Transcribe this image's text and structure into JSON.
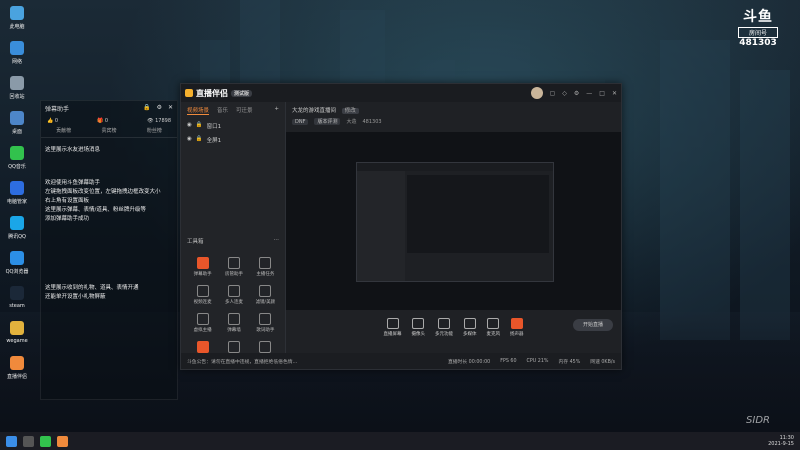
{
  "desktop": {
    "icons": [
      {
        "label": "此电脑",
        "color": "#4aa3df"
      },
      {
        "label": "网络",
        "color": "#3a8edb"
      },
      {
        "label": "回收站",
        "color": "#8a9aa8"
      },
      {
        "label": "桌面",
        "color": "#4d86c9"
      },
      {
        "label": "QQ音乐",
        "color": "#32c24d"
      },
      {
        "label": "电脑管家",
        "color": "#2d6de0"
      },
      {
        "label": "腾讯QQ",
        "color": "#1aa6e8"
      },
      {
        "label": "QQ浏览器",
        "color": "#2c8fe6"
      },
      {
        "label": "steam",
        "color": "#1b2838"
      },
      {
        "label": "wegame",
        "color": "#e2b23d"
      },
      {
        "label": "直播伴侣",
        "color": "#f08a3c"
      }
    ]
  },
  "room_badge": {
    "logo": "斗鱼",
    "label": "房间号",
    "number": "481303"
  },
  "danmu_panel": {
    "title": "弹幕助手",
    "controls": [
      "🔒",
      "⚙",
      "✕"
    ],
    "stats": [
      "👍 0",
      "🎁 0",
      "👁 17898"
    ],
    "subtabs": [
      "贡献榜",
      "贵宾榜",
      "粉丝榜"
    ],
    "messages": [
      "这里展示水友进场消息",
      "欢迎使用斗鱼弹幕助手",
      "左键拖拽面板改变位置，左键拖拽边框改变大小",
      "右上角有设置面板",
      "这里展示弹幕、表情/道具、粉丝牌升级等",
      "添加弹幕助手成功",
      "这里展示收到的礼物、道具、表情开通",
      "还能单开设置小礼物屏蔽"
    ]
  },
  "app": {
    "name": "直播伴侣",
    "version": "测试版",
    "scene_tabs": [
      "视频场景",
      "音乐",
      "可迁景"
    ],
    "scenes": [
      "窗口1",
      "全屏1"
    ],
    "stream_title": "大龙的游戏直播间",
    "edit_label": "修改",
    "tags": [
      "DNF",
      "版本评测"
    ],
    "heat_label": "大造",
    "heat_value": "481303",
    "tools_header": "工具箱",
    "tools": [
      "弹幕助手",
      "房管助手",
      "主播任务",
      "视频连麦",
      "多人连麦",
      "滤镜/美颜",
      "虚拟主播",
      "弹幕墙",
      "歌词助手",
      "礼物特效",
      "投票",
      "更多"
    ],
    "controls": [
      "直播屏幕",
      "摄像头",
      "多元功能",
      "多媒体",
      "麦克风",
      "扬声器"
    ],
    "start_button": "开始直播",
    "status_notice": "斗鱼公告：请勿在直播中违规，直播拒绝低俗色情…",
    "status_items": [
      "直播时长 00:00:00",
      "FPS 60",
      "CPU 21%",
      "内存 45%",
      "网速 0KB/s"
    ]
  },
  "taskbar": {
    "time": "11:30",
    "date": "2021-9-15"
  },
  "signature": "SIDR"
}
